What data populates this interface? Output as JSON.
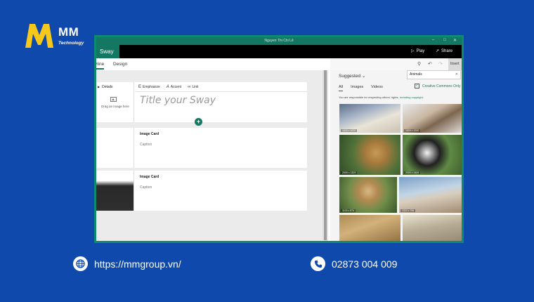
{
  "brand": {
    "name": "MM",
    "tagline": "Technology"
  },
  "window": {
    "title": "Nguyen Thi Chi Lê"
  },
  "app": {
    "name": "Sway",
    "play_label": "Play",
    "share_label": "Share",
    "more": "⋮"
  },
  "tabs": [
    "Storyline",
    "Design"
  ],
  "storyline": {
    "details_label": "Details",
    "drag_label": "Drag an image here",
    "toolbar": {
      "emphasize": "Emphasize",
      "accent": "Accent",
      "link": "Link"
    },
    "title_placeholder": "Title your Sway",
    "cards": [
      {
        "heading": "Image Card",
        "caption": "Caption"
      },
      {
        "heading": "Image Card",
        "caption": "Caption"
      }
    ]
  },
  "panel": {
    "suggested_label": "Suggested",
    "search_value": "Animals",
    "insert_label": "Insert",
    "filters": [
      "All",
      "Images",
      "Videos"
    ],
    "cc_label": "Creative Commons Only",
    "rights_text": "You are responsible for respecting others' rights,",
    "rights_link": "including copyright.",
    "thumbs": [
      {
        "dims": "1600 x 1000",
        "subject": "polar bears"
      },
      {
        "dims": "1600 x 1200",
        "subject": "fox in snow"
      },
      {
        "dims": "2000 x 1329",
        "subject": "lion"
      },
      {
        "dims": "2000 x 1409",
        "subject": "pandas"
      },
      {
        "dims": "1100 x 874",
        "subject": "lion cub"
      },
      {
        "dims": "1024 x 768",
        "subject": "wolf"
      },
      {
        "dims": "",
        "subject": "lions"
      },
      {
        "dims": "",
        "subject": "elephants"
      }
    ]
  },
  "contact": {
    "website": "https://mmgroup.vn/",
    "phone": "02873 004 009"
  },
  "colors": {
    "background": "#0f49ac",
    "accent": "#137862",
    "logo_yellow": "#f7c81c"
  }
}
